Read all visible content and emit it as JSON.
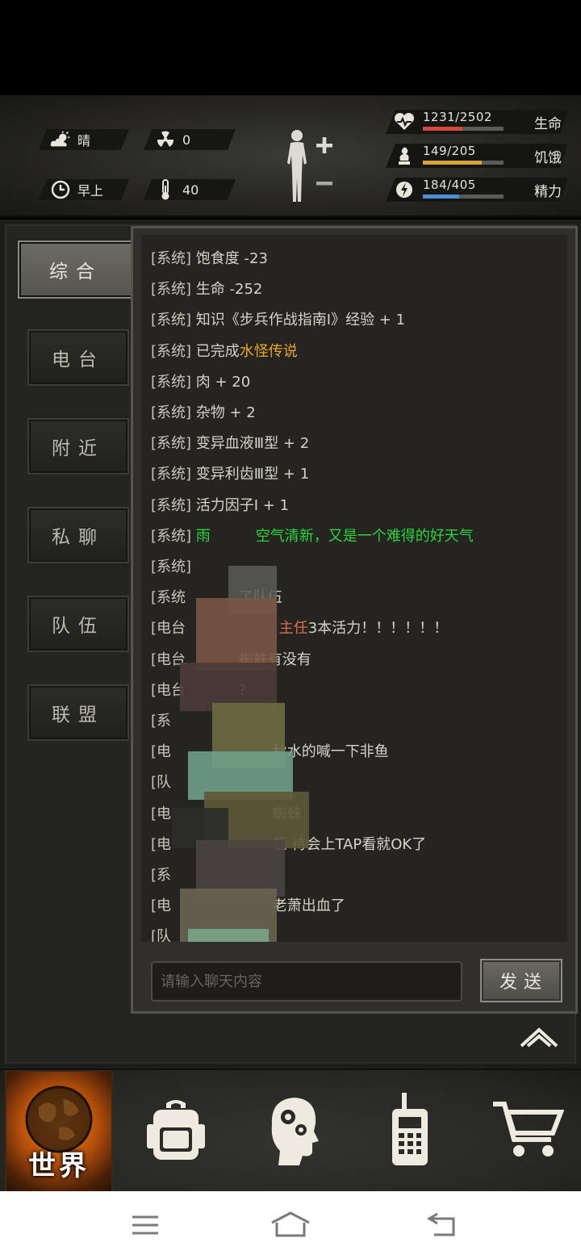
{
  "hud": {
    "weather": {
      "icon": "cloudy-sun-icon",
      "label": "晴"
    },
    "radiation": {
      "icon": "radiation-icon",
      "value": "0"
    },
    "time_of_day": {
      "icon": "clock-icon",
      "label": "早上"
    },
    "temperature": {
      "icon": "thermometer-icon",
      "value": "40"
    },
    "vitals": [
      {
        "name": "生命",
        "value": "1231/2502",
        "fraction": 0.49,
        "color": "#d9473a",
        "icon": "heart-icon"
      },
      {
        "name": "饥饿",
        "value": "149/205",
        "fraction": 0.73,
        "color": "#d9a43a",
        "icon": "food-icon"
      },
      {
        "name": "精力",
        "value": "184/405",
        "fraction": 0.45,
        "color": "#4a8fd0",
        "icon": "energy-icon"
      }
    ]
  },
  "tabs": [
    {
      "label": "综合",
      "active": true
    },
    {
      "label": "电台",
      "active": false
    },
    {
      "label": "附近",
      "active": false
    },
    {
      "label": "私聊",
      "active": false
    },
    {
      "label": "队伍",
      "active": false
    },
    {
      "label": "联盟",
      "active": false
    }
  ],
  "chat": {
    "messages": [
      {
        "tag": "[系统]",
        "text": "饱食度 -23"
      },
      {
        "tag": "[系统]",
        "text": "生命 -252"
      },
      {
        "tag": "[系统]",
        "text": "知识《步兵作战指南Ⅰ》经验 + 1"
      },
      {
        "tag": "[系统]",
        "text": "已完成",
        "highlight": "水怪传说"
      },
      {
        "tag": "[系统]",
        "text": "肉 + 20"
      },
      {
        "tag": "[系统]",
        "text": "杂物 + 2"
      },
      {
        "tag": "[系统]",
        "text": "变异血液Ⅲ型 + 2"
      },
      {
        "tag": "[系统]",
        "text": "变异利齿Ⅲ型 + 1"
      },
      {
        "tag": "[系统]",
        "text": "活力因子Ⅰ + 1"
      },
      {
        "tag": "[系统]",
        "text": "雨",
        "green_tail": "空气清新，又是一个难得的好天气"
      },
      {
        "tag": "[系统]",
        "text": ""
      },
      {
        "tag": "[系统",
        "text": "了队伍"
      },
      {
        "tag": "[电台",
        "pink": "主任",
        "text": "3本活力！！！！！！"
      },
      {
        "tag": "[电台",
        "text": "蜘蛛有没有"
      },
      {
        "tag": "[电台",
        "text": "?"
      },
      {
        "tag": "[系",
        "text": ""
      },
      {
        "tag": "[电",
        "text": "秋水的喊一下非鱼"
      },
      {
        "tag": "[队",
        "text": ""
      },
      {
        "tag": "[电",
        "text": "蜘蛛"
      },
      {
        "tag": "[电",
        "text": "任 待会上TAP看就OK了"
      },
      {
        "tag": "[系",
        "text": ""
      },
      {
        "tag": "[电",
        "text": "老萧出血了"
      },
      {
        "tag": "[队",
        "text": ""
      }
    ],
    "input_placeholder": "请输入聊天内容",
    "send_label": "发送"
  },
  "bottom_nav": {
    "world_label": "世界",
    "items": [
      "world-globe-icon",
      "backpack-icon",
      "skills-head-icon",
      "radio-walkie-icon",
      "shop-cart-icon"
    ]
  },
  "system_nav": [
    "menu-icon",
    "home-icon",
    "back-icon"
  ]
}
